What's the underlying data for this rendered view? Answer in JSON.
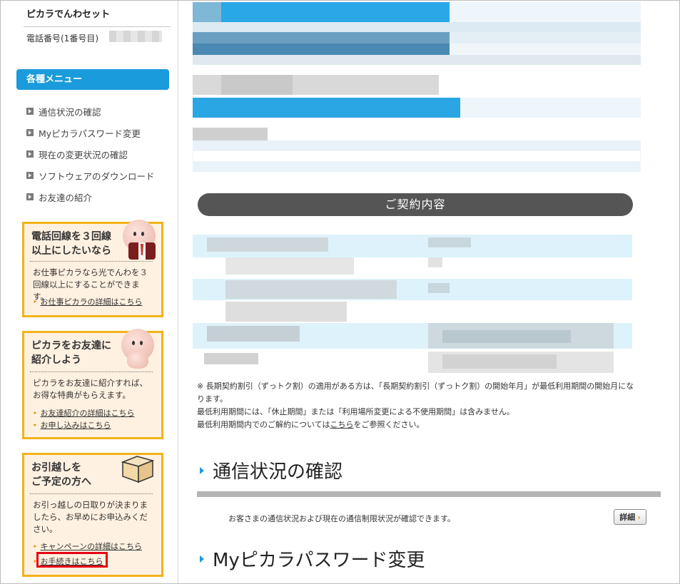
{
  "sidebar": {
    "plan_name": "ピカラでんわセット",
    "phone_label": "電話番号(1番号目)",
    "menu_title": "各種メニュー",
    "menu_items": [
      {
        "label": "通信状況の確認"
      },
      {
        "label": "Myピカラパスワード変更"
      },
      {
        "label": "現在の変更状況の確認"
      },
      {
        "label": "ソフトウェアのダウンロード"
      },
      {
        "label": "お友達の紹介"
      }
    ],
    "promos": [
      {
        "title_line1": "電話回線を３回線",
        "title_line2": "以上にしたいなら",
        "body": "お仕事ピカラなら光でんわを３回線以上にすることができます。",
        "links": [
          "お仕事ピカラの詳細はこちら"
        ]
      },
      {
        "title_line1": "ピカラをお友達に",
        "title_line2": "紹介しよう",
        "body": "ピカラをお友達に紹介すれば、お得な特典がもらえます。",
        "links": [
          "お友達紹介の詳細はこちら",
          "お申し込みはこちら"
        ]
      },
      {
        "title_line1": "お引越しを",
        "title_line2": "ご予定の方へ",
        "body": "お引っ越しの日取りが決まりましたら、お早めにお申込みください。",
        "links": [
          "キャンペーンの詳細はこちら",
          "お手続きはこちら"
        ]
      }
    ]
  },
  "main": {
    "contract_heading": "ご契約内容",
    "note_line1": "※ 長期契約割引（ずっトク割）の適用がある方は、「長期契約割引（ずっトク割）の開始年月」が最低利用期間の開始月になります。",
    "note_line2": "最低利用期間には、「休止期間」または「利用場所変更による不使用期間」は含みません。",
    "note_line3_pre": "最低利用期間内でのご解約については",
    "note_line3_link": "こちら",
    "note_line3_post": "をご参照ください。",
    "section1_title": "通信状況の確認",
    "section1_desc": "お客さまの通信状況および現在の通信制限状況が確認できます。",
    "detail_button": "詳細",
    "section2_title": "Myピカラパスワード変更"
  },
  "colors": {
    "accent": "#1a9bdc",
    "promo_border": "#f2b21b",
    "promo_bg": "#fff1e1",
    "highlight": "#e60012",
    "contract_bar": "#555555"
  }
}
